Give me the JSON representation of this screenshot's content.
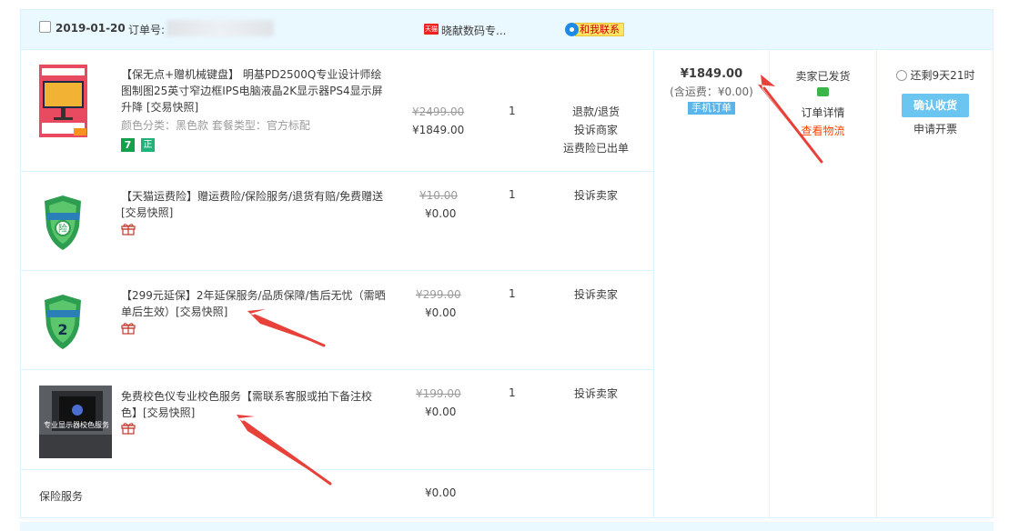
{
  "order": {
    "date": "2019-01-20",
    "order_no_label": "订单号:",
    "shop_badge": "天猫",
    "shop_name": "晓献数码专...",
    "contact_label": "和我联系"
  },
  "items": [
    {
      "title": "【保无点+赠机械键盘】 明基PD2500Q专业设计师绘图制图25英寸窄边框IPS电脑液晶2K显示器PS4显示屏 升降 [交易快照]",
      "sku": "颜色分类：黑色款    套餐类型：官方标配",
      "badges": [
        "7",
        "正"
      ],
      "orig_price": "¥2499.00",
      "price": "¥1849.00",
      "qty": "1",
      "ops": [
        "退款/退货",
        "投诉商家",
        "运费险已出单"
      ]
    },
    {
      "title": "【天猫运费险】赠运费险/保险服务/退货有赔/免费赠送 [交易快照]",
      "orig_price": "¥10.00",
      "price": "¥0.00",
      "qty": "1",
      "ops": [
        "投诉卖家"
      ]
    },
    {
      "title": "【299元延保】2年延保服务/品质保障/售后无忧（需晒单后生效）[交易快照]",
      "orig_price": "¥299.00",
      "price": "¥0.00",
      "qty": "1",
      "ops": [
        "投诉卖家"
      ]
    },
    {
      "title": "免费校色仪专业校色服务【需联系客服或拍下备注校色】[交易快照]",
      "thumb_caption": "专业显示器校色服务",
      "orig_price": "¥199.00",
      "price": "¥0.00",
      "qty": "1",
      "ops": [
        "投诉卖家"
      ]
    },
    {
      "title": "保险服务",
      "price": "¥0.00"
    }
  ],
  "summary": {
    "total": "¥1849.00",
    "shipping": "(含运费：¥0.00)",
    "mobile_tag": "手机订单"
  },
  "status": {
    "text": "卖家已发货",
    "detail": "订单详情",
    "logistics": "查看物流"
  },
  "action": {
    "remaining": "还剩9天21时",
    "confirm": "确认收货",
    "invoice": "申请开票"
  },
  "colors": {
    "border": "#daf3ff",
    "header_bg": "#eaf8ff",
    "confirm_btn": "#6ac5f1",
    "link_orange": "#ff4400",
    "arrow": "#e8413a"
  }
}
